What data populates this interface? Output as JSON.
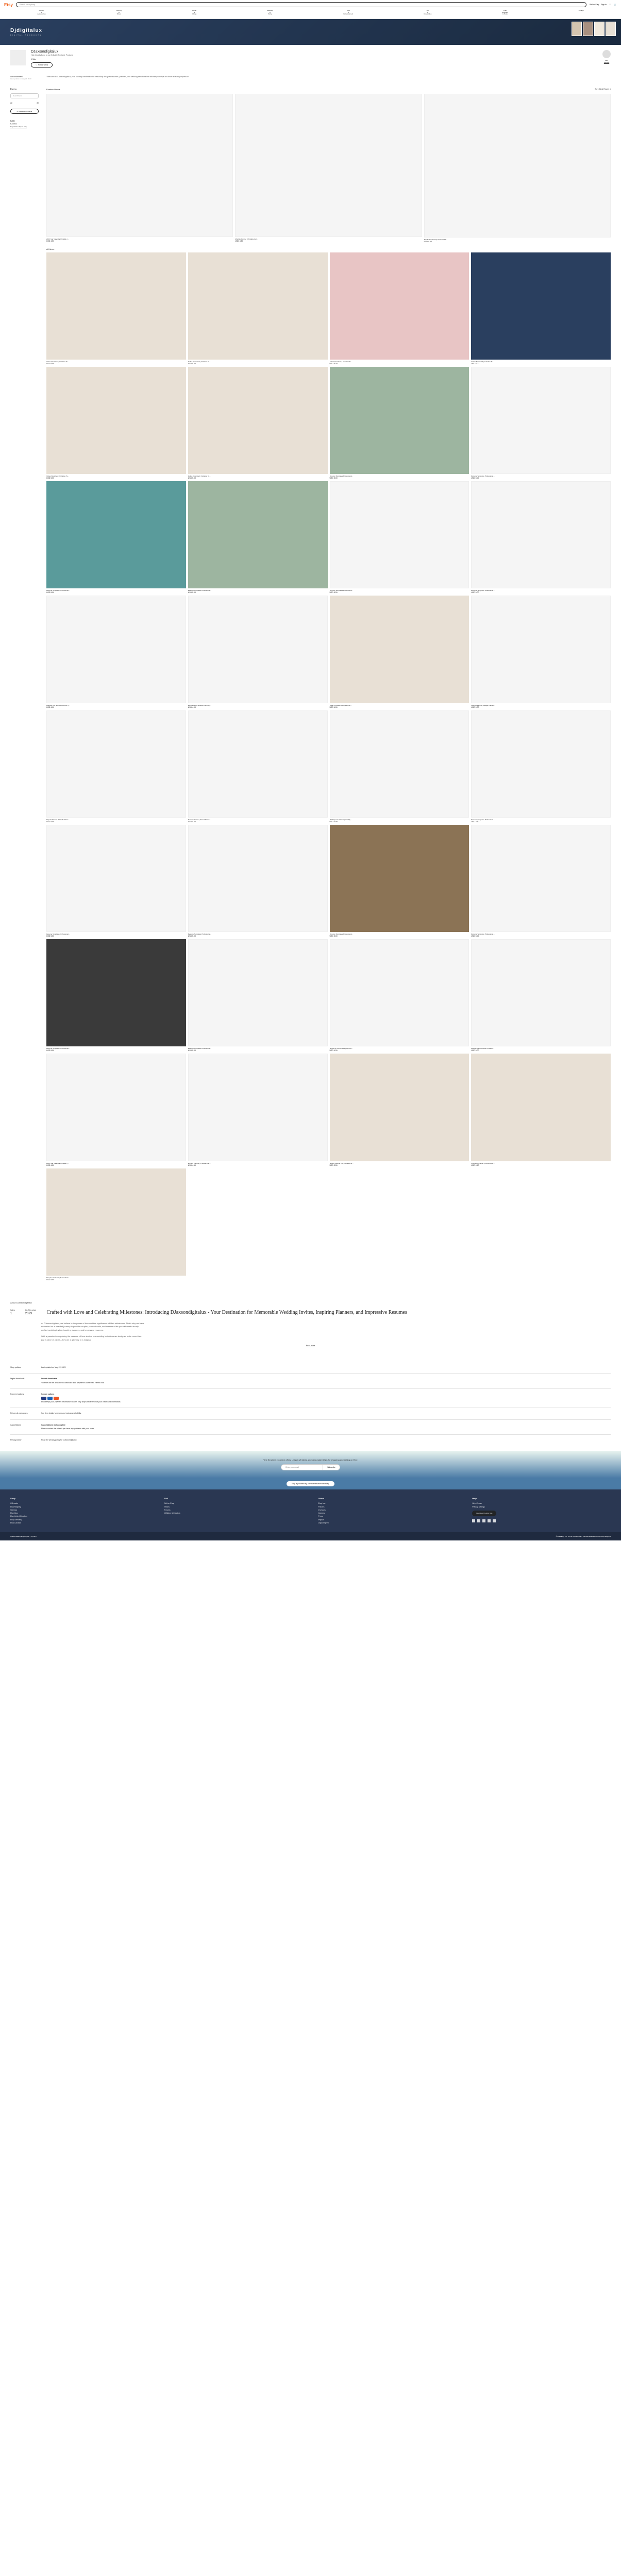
{
  "header": {
    "logo": "Etsy",
    "search_placeholder": "Search for anything",
    "sell_link": "Sell on Etsy",
    "signin": "Sign in",
    "categories": [
      "Jewelry & Accessories",
      "Clothing & Shoes",
      "Home & Living",
      "Wedding & Party",
      "Toys & Entertainment",
      "Art & Collectibles",
      "Craft Supplies & Tools",
      "Vintage"
    ]
  },
  "banner": {
    "title": "Djdigitalux",
    "subtitle": "DIGITAL PRODUCTS"
  },
  "shop": {
    "name": "DJaxsondigitalux",
    "tagline": "High Quality Easy to use Editable Printable Products",
    "sales": "1 Sale",
    "follow": "Follow shop",
    "owner_name": "djax",
    "contact": "Contact"
  },
  "announcement": {
    "label": "Announcement",
    "updated": "Last updated on May 22, 2023",
    "text": "\"Welcome to DJaxsondigitalux, your one-stop destination for beautifully designed resumes, planners, and wedding invitations that elevate your style and leave a lasting impression."
  },
  "sidebar": {
    "items_title": "Items",
    "search_placeholder": "Search items",
    "all_label": "All",
    "all_count": "30",
    "contact_owner": "Contact shop owner",
    "links": [
      "1 Sale",
      "1 Admirer",
      "Report this shop to Etsy"
    ]
  },
  "items_area": {
    "featured_label": "Featured items",
    "sort_label": "Sort: Most Recent ▾",
    "all_items_label": "All Items"
  },
  "featured": [
    {
      "title": "2023 Year Calendar Printable | ...",
      "price": "USD 4.50"
    },
    {
      "title": "Monthly Planner | Printable Cal...",
      "price": "USD 4.50"
    },
    {
      "title": "Simple Functional | Personal Da...",
      "price": "USD 4.50"
    }
  ],
  "items": [
    {
      "title": "Invites Download | Invitation Te...",
      "price": "USD 5.00",
      "cls": "img-cream"
    },
    {
      "title": "Invites Download | Invitation Te...",
      "price": "USD 5.00",
      "cls": "img-cream"
    },
    {
      "title": "Invites Download | Invitation Te...",
      "price": "USD 5.00",
      "cls": "img-pink"
    },
    {
      "title": "Invites Download | Invitation Te...",
      "price": "USD 5.00",
      "cls": "img-navy"
    },
    {
      "title": "Invites Download | Invitation Te...",
      "price": "USD 5.00",
      "cls": "img-cream"
    },
    {
      "title": "Invites Download | Invitation Te...",
      "price": "USD 5.00",
      "cls": "img-cream"
    },
    {
      "title": "Resume Templates Professional...",
      "price": "USD 5.00",
      "cls": "img-sage"
    },
    {
      "title": "Resume Templates Professional...",
      "price": "USD 5.00",
      "cls": "img-white"
    },
    {
      "title": "Resume Templates Professional...",
      "price": "USD 5.00",
      "cls": "img-teal"
    },
    {
      "title": "Resume Templates Professional...",
      "price": "USD 5.00",
      "cls": "img-sage"
    },
    {
      "title": "Resume Templates Professional...",
      "price": "USD 5.00",
      "cls": "img-white"
    },
    {
      "title": "Resume Templates Professional...",
      "price": "USD 5.00",
      "cls": "img-white"
    },
    {
      "title": "Workout Log, Workout Planner |...",
      "price": "USD 4.00",
      "cls": "img-white"
    },
    {
      "title": "Workout Log, Workout Planner |...",
      "price": "USD 4.00",
      "cls": "img-white"
    },
    {
      "title": "Today's Planner, Daily Planner...",
      "price": "USD 4.00",
      "cls": "img-cream"
    },
    {
      "title": "Savings Planner, Budget Planner...",
      "price": "USD 4.00",
      "cls": "img-white"
    },
    {
      "title": "Project Planner, Printable Plann...",
      "price": "USD 4.00",
      "cls": "img-white"
    },
    {
      "title": "Itinerary Planner, Travel Planne...",
      "price": "USD 4.00",
      "cls": "img-white"
    },
    {
      "title": "Bill Payment Tracker | Monthly ...",
      "price": "USD 3.99",
      "cls": "img-white"
    },
    {
      "title": "Resume Templates Professional...",
      "price": "USD 3.50",
      "cls": "img-white"
    },
    {
      "title": "Resume Templates Professional...",
      "price": "USD 5.50",
      "cls": "img-white"
    },
    {
      "title": "Resume Templates Professional...",
      "price": "USD 5.00",
      "cls": "img-white"
    },
    {
      "title": "Resume Templates Professional...",
      "price": "USD 5.00",
      "cls": "img-brown"
    },
    {
      "title": "Resume Templates Professional...",
      "price": "USD 5.00",
      "cls": "img-white"
    },
    {
      "title": "Resume Templates Professional...",
      "price": "USD 5.00",
      "cls": "img-dark"
    },
    {
      "title": "Resume Templates Professional...",
      "price": "USD 5.00",
      "cls": "img-white"
    },
    {
      "title": "Wheel Of Life Printable| Life Pla...",
      "price": "USD 4.00",
      "cls": "img-white"
    },
    {
      "title": "Monthly Habit Tracker Printable...",
      "price": "USD 5.00",
      "cls": "img-white"
    },
    {
      "title": "2023 Year Calendar Printable | ...",
      "price": "USD 4.50",
      "cls": "img-white"
    },
    {
      "title": "Monthly Planner | Printable Cal...",
      "price": "USD 4.50",
      "cls": "img-white"
    },
    {
      "title": "Weekly Planner Pdf | Undated W...",
      "price": "USD 3.50",
      "cls": "img-cream"
    },
    {
      "title": "Simple Functional | Personal Da...",
      "price": "USD 4.50",
      "cls": "img-cream"
    },
    {
      "title": "Simple Functional | Personal Da...",
      "price": "USD 4.50",
      "cls": "img-cream"
    }
  ],
  "about": {
    "heading": "About DJaxsondigitalux",
    "sales_label": "Sales",
    "sales_num": "1",
    "since_label": "On Etsy since",
    "since_num": "2023",
    "title": "Crafted with Love and Celebrating Milestones: Introducing DJaxsondigitalux - Your Destination for Memorable Wedding Invites, Inspiring Planners, and Impressive Resumes",
    "body1": "At DJaxsondigitalux, we believe in the power of love and the significance of life's milestones. That's why we have embarked on a heartfelt journey to provide couples, professionals, and dreamers like you with meticulously crafted wedding invites, inspiring planners, and impressive resumes.",
    "body2": "With a passion for capturing the essence of love stories, our wedding invitations are designed to be more than just a piece of paper—they are a gateway to a magical",
    "read_more": "Read more"
  },
  "policies": {
    "heading": "Shop policies",
    "updated": "Last updated on May 22, 2023",
    "rows": [
      {
        "label": "Digital downloads",
        "title": "Instant downloads",
        "text": "Your files will be available to download once payment is confirmed. Here's how."
      },
      {
        "label": "Payment options",
        "title": "Secure options",
        "text": "Etsy keeps your payment information secure. Etsy shops never receive your credit card information."
      },
      {
        "label": "Returns & exchanges",
        "title": "",
        "text": "See item details for return and exchange eligibility."
      },
      {
        "label": "Cancellations",
        "title": "Cancellations: not accepted",
        "text": "Please contact the seller if you have any problems with your order."
      },
      {
        "label": "Privacy policy",
        "title": "",
        "text": "Read the privacy policy for DJaxsondigitalux"
      }
    ]
  },
  "newsletter": {
    "text": "Yes! Send me exclusive offers, unique gift ideas, and personalized tips for shopping and selling on Etsy.",
    "placeholder": "Enter your email",
    "button": "Subscribe"
  },
  "renewable": "Etsy is powered by 100% renewable electricity.",
  "footer": {
    "cols": [
      {
        "title": "Shop",
        "links": [
          "Gift cards",
          "Etsy Registry",
          "Sitemap",
          "Etsy blog",
          "Etsy United Kingdom",
          "Etsy Germany",
          "Etsy Canada"
        ]
      },
      {
        "title": "Sell",
        "links": [
          "Sell on Etsy",
          "Teams",
          "Forums",
          "Affiliates & Creators"
        ]
      },
      {
        "title": "About",
        "links": [
          "Etsy, Inc.",
          "Policies",
          "Investors",
          "Careers",
          "Press",
          "Impact",
          "Legal imprint"
        ]
      },
      {
        "title": "Help",
        "links": [
          "Help Center",
          "Privacy settings"
        ]
      }
    ],
    "app_btn": "Download the Etsy App"
  },
  "footer_bottom": {
    "left": "United States | English (US) | $ (USD)",
    "right": "© 2023 Etsy, Inc. Terms of Use Privacy Interest-based ads Local Shops Regions"
  }
}
